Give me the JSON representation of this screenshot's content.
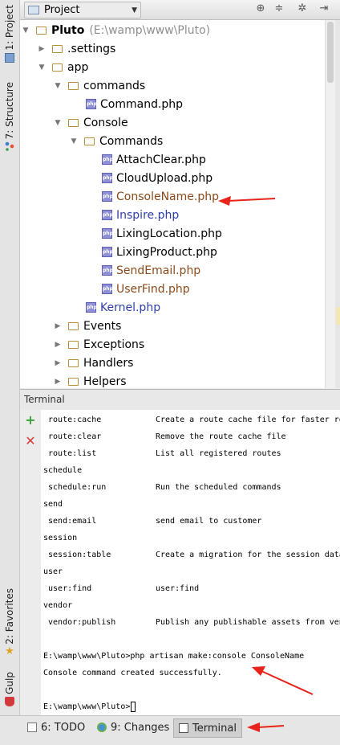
{
  "left_strip": {
    "tabs": [
      {
        "label": "1: Project",
        "icon": "project-icon"
      },
      {
        "label": "7: Structure",
        "icon": "structure-icon"
      },
      {
        "label": "2: Favorites",
        "icon": "star-icon"
      },
      {
        "label": "Gulp",
        "icon": "gulp-icon"
      }
    ]
  },
  "project_panel": {
    "title": "Project",
    "icons": [
      "sync-icon",
      "collapse-icon",
      "gear-icon",
      "hide-icon"
    ]
  },
  "tree": {
    "root": {
      "label": "Pluto",
      "path": "(E:\\wamp\\www\\Pluto)"
    },
    "items": [
      {
        "label": ".settings"
      },
      {
        "label": "app"
      },
      {
        "label": "commands"
      },
      {
        "label": "Command.php"
      },
      {
        "label": "Console"
      },
      {
        "label": "Commands"
      },
      {
        "label": "AttachClear.php"
      },
      {
        "label": "CloudUpload.php"
      },
      {
        "label": "ConsoleName.php"
      },
      {
        "label": "Inspire.php"
      },
      {
        "label": "LixingLocation.php"
      },
      {
        "label": "LixingProduct.php"
      },
      {
        "label": "SendEmail.php"
      },
      {
        "label": "UserFind.php"
      },
      {
        "label": "Kernel.php"
      },
      {
        "label": "Events"
      },
      {
        "label": "Exceptions"
      },
      {
        "label": "Handlers"
      },
      {
        "label": "Helpers"
      }
    ]
  },
  "terminal": {
    "title": "Terminal",
    "lines": [
      {
        "name": " route:cache",
        "desc": "Create a route cache file for faster ro"
      },
      {
        "name": " route:clear",
        "desc": "Remove the route cache file"
      },
      {
        "name": " route:list",
        "desc": "List all registered routes"
      },
      {
        "name": "schedule",
        "desc": ""
      },
      {
        "name": " schedule:run",
        "desc": "Run the scheduled commands"
      },
      {
        "name": "send",
        "desc": ""
      },
      {
        "name": " send:email",
        "desc": "send email to customer"
      },
      {
        "name": "session",
        "desc": ""
      },
      {
        "name": " session:table",
        "desc": "Create a migration for the session data"
      },
      {
        "name": "user",
        "desc": ""
      },
      {
        "name": " user:find",
        "desc": "user:find"
      },
      {
        "name": "vendor",
        "desc": ""
      },
      {
        "name": " vendor:publish",
        "desc": "Publish any publishable assets from ven"
      }
    ],
    "command": "E:\\wamp\\www\\Pluto>php artisan make:console ConsoleName",
    "result": "Console command created successfully.",
    "prompt": "E:\\wamp\\www\\Pluto>"
  },
  "bottom_tabs": [
    {
      "label": "6: TODO",
      "icon": "todo-icon"
    },
    {
      "label": "9: Changes",
      "icon": "changes-icon"
    },
    {
      "label": "Terminal",
      "icon": "terminal-icon"
    }
  ],
  "colors": {
    "modified": "#8a4a1b",
    "added": "#2f3fa8",
    "annotation": "#e8231b"
  }
}
